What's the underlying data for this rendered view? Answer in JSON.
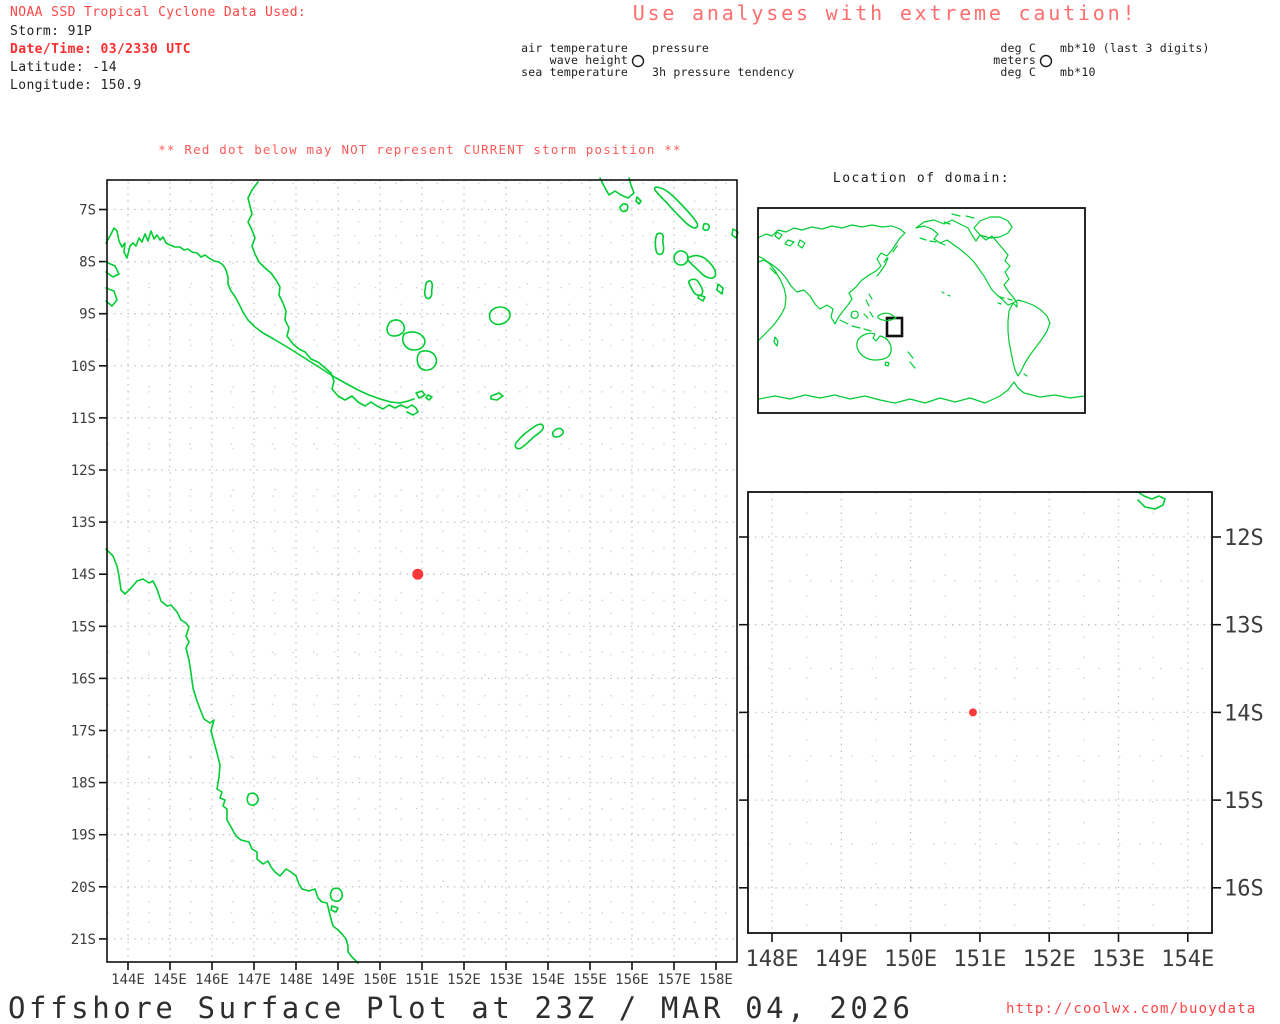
{
  "header": {
    "source_line": "NOAA SSD Tropical Cyclone Data Used:",
    "storm": "Storm: 91P",
    "datetime": "Date/Time: 03/2330 UTC",
    "latitude": "Latitude: -14",
    "longitude": "Longitude: 150.9"
  },
  "caution_title": "Use analyses with extreme caution!",
  "warning": "** Red dot below may NOT represent CURRENT storm position **",
  "legend": {
    "left": {
      "r1": "air temperature",
      "r2": "wave height",
      "r3": "sea temperature",
      "p1": "pressure",
      "p2": "3h pressure tendency"
    },
    "right": {
      "r1": "deg C",
      "r2": "meters",
      "r3": "deg C",
      "p1": "mb*10 (last 3 digits)",
      "p2": "mb*10"
    }
  },
  "inset": {
    "title": "Location of domain:"
  },
  "main_map": {
    "x_ticks": [
      "144E",
      "145E",
      "146E",
      "147E",
      "148E",
      "149E",
      "150E",
      "151E",
      "152E",
      "153E",
      "154E",
      "155E",
      "156E",
      "157E",
      "158E"
    ],
    "y_ticks": [
      "7S",
      "8S",
      "9S",
      "10S",
      "11S",
      "12S",
      "13S",
      "14S",
      "15S",
      "16S",
      "17S",
      "18S",
      "19S",
      "20S",
      "21S"
    ],
    "storm_dot": {
      "lat_s": 14,
      "lon_e": 150.9
    }
  },
  "zoom_map": {
    "x_ticks": [
      "148E",
      "149E",
      "150E",
      "151E",
      "152E",
      "153E",
      "154E"
    ],
    "y_ticks": [
      "12S",
      "13S",
      "14S",
      "15S",
      "16S"
    ],
    "storm_dot": {
      "lat_s": 14,
      "lon_e": 150.9
    }
  },
  "footer": {
    "title": "Offshore Surface Plot at 23Z / MAR 04, 2026",
    "url": "http://coolwx.com/buoydata"
  },
  "colors": {
    "coastline_green": "#00cc33",
    "storm_dot_red": "#fa3a3a",
    "caution_red": "#ff6e6e",
    "header_red": "#ff4646",
    "url_red": "#ff4646",
    "grid_gray": "#c7c7c7"
  }
}
